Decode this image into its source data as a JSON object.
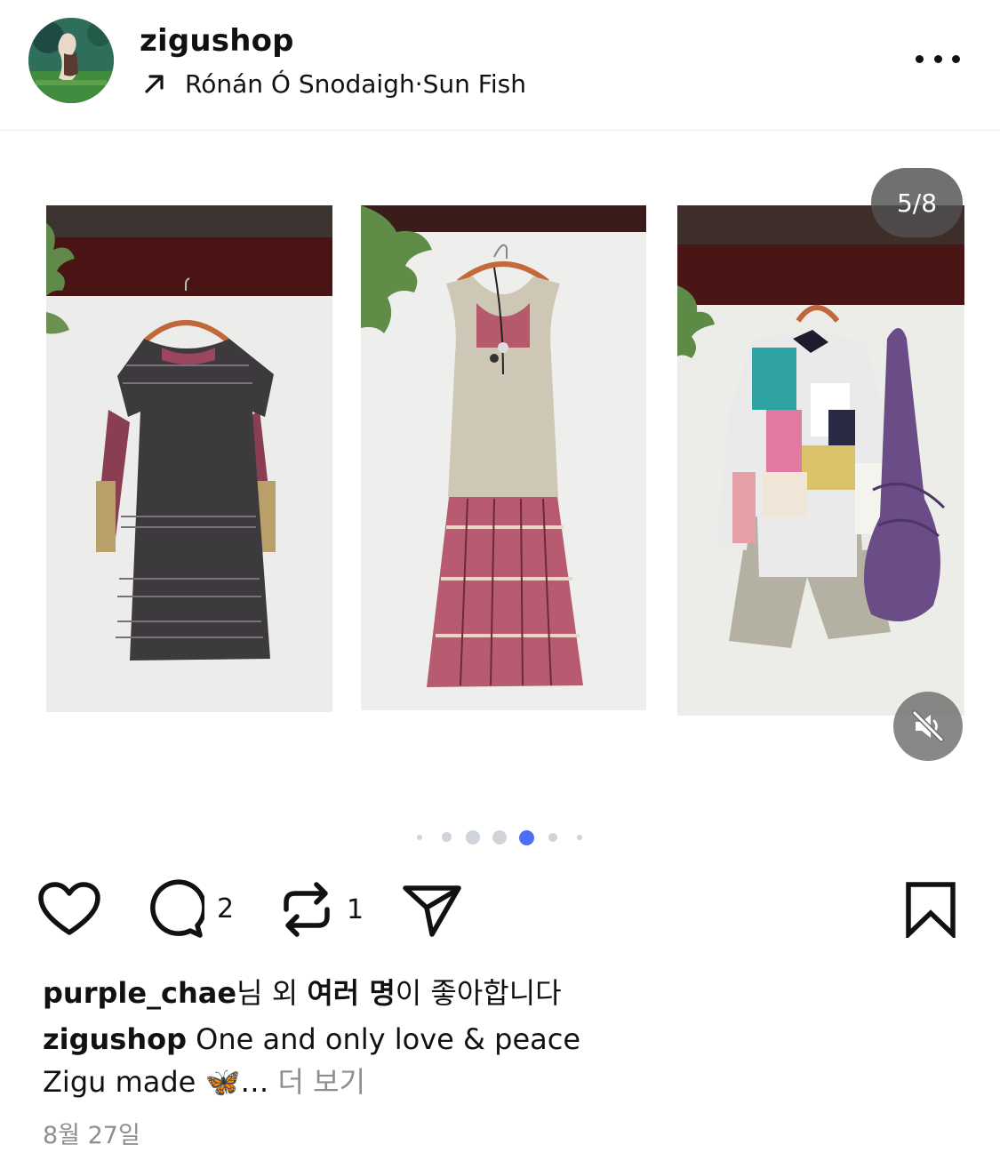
{
  "header": {
    "username": "zigushop",
    "music_artist": "Rónán Ó Snodaigh",
    "music_separator": " · ",
    "music_title": "Sun Fish"
  },
  "media": {
    "counter": "5/8",
    "muted": true,
    "dots_total": 7,
    "dots_active_index": 4
  },
  "actions": {
    "comment_count": "2",
    "repost_count": "1"
  },
  "likes": {
    "user": "purple_chae",
    "part1": "님 외 ",
    "bold_others": "여러 명",
    "part2": "이 좋아합니다"
  },
  "caption": {
    "username": "zigushop",
    "text": " One and only love & peace",
    "text_line2": "Zigu made 🦋…",
    "more_label": " 더 보기"
  },
  "date": "8월 27일",
  "colors": {
    "active_dot": "#4f6ef7",
    "inactive_dot": "#cfd3da",
    "muted_text": "#8e8e8e"
  }
}
